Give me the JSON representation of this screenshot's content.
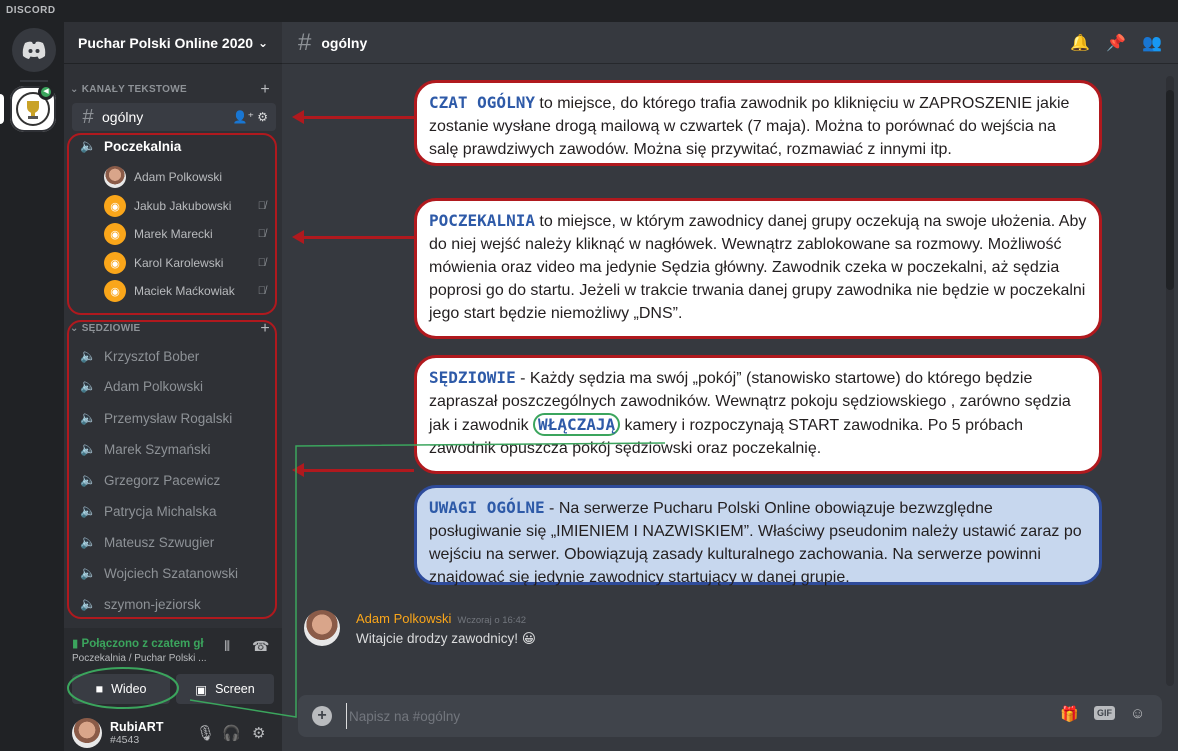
{
  "app": {
    "brand": "DISCORD"
  },
  "server": {
    "name": "Puchar Polski Online 2020"
  },
  "categories": {
    "text": "KANAŁY TEKSTOWE",
    "judges": "SĘDZIOWIE"
  },
  "channels": {
    "general": "ogólny",
    "waiting_room": "Poczekalnia"
  },
  "waiting_users": [
    {
      "name": "Adam Polkowski"
    },
    {
      "name": "Jakub Jakubowski"
    },
    {
      "name": "Marek Marecki"
    },
    {
      "name": "Karol Karolewski"
    },
    {
      "name": "Maciek Maćkowiak"
    }
  ],
  "judge_rooms": [
    "Krzysztof Bober",
    "Adam Polkowski",
    "Przemysław Rogalski",
    "Marek Szymański",
    "Grzegorz Pacewicz",
    "Patrycja Michalska",
    "Mateusz Szwugier",
    "Wojciech Szatanowski",
    "szymon-jeziorsk"
  ],
  "voice_panel": {
    "status": "Połączono z czatem gł",
    "location": "Poczekalnia / Puchar Polski ...",
    "video_label": "Wideo",
    "screen_label": "Screen"
  },
  "me": {
    "name": "RubiART",
    "tag": "#4543"
  },
  "main": {
    "channel": "ogólny"
  },
  "notes": [
    {
      "keyword": "CZAT OGÓLNY",
      "text": " to miejsce, do którego trafia zawodnik po kliknięciu w ZAPROSZENIE jakie zostanie wysłane drogą mailową w czwartek (7 maja). Można to porównać do wejścia na salę prawdziwych zawodów. Można się przywitać, rozmawiać z innymi itp."
    },
    {
      "keyword": "POCZEKALNIA",
      "text": " to miejsce, w którym zawodnicy danej grupy oczekują na swoje ułożenia. Aby do niej wejść należy kliknąć w nagłówek. Wewnątrz zablokowane sa rozmowy. Możliwość mówienia oraz video ma jedynie Sędzia główny. Zawodnik czeka w poczekalni, aż sędzia poprosi go do startu. Jeżeli w trakcie trwania danej grupy zawodnika nie będzie w poczekalni jego start będzie niemożliwy „DNS”."
    },
    {
      "keyword": "SĘDZIOWIE",
      "text_before": " - Każdy sędzia ma swój „pokój” (stanowisko startowe) do którego będzie zapraszał poszczególnych zawodników. Wewnątrz pokoju sędziowskiego , zarówno sędzia jak i zawodnik ",
      "highlight": "WŁĄCZAJĄ",
      "text_after": " kamery i rozpoczynają START zawodnika. Po 5 próbach zawodnik opuszcza pokój sędziowski oraz poczekalnię."
    },
    {
      "keyword": "UWAGI OGÓLNE",
      "text": " - Na serwerze Pucharu Polski Online obowiązuje bezwzględne posługiwanie się „IMIENIEM I NAZWISKIEM”. Właściwy pseudonim należy ustawić zaraz po wejściu na serwer. Obowiązują zasady kulturalnego zachowania. Na serwerze powinni znajdować się jedynie zawodnicy startujący w danej grupie."
    }
  ],
  "message": {
    "author": "Adam Polkowski",
    "time": "Wczoraj o 16:42",
    "text": "Witajcie drodzy zawodnicy!",
    "emoji": "😀"
  },
  "composer": {
    "placeholder": "Napisz na #ogólny",
    "gif_label": "GIF"
  },
  "colors": {
    "annotation_red": "#b0191e",
    "annotation_blue": "#2e4b9b",
    "keyword_blue": "#2e5aa8",
    "connected_green": "#3ba55d"
  }
}
